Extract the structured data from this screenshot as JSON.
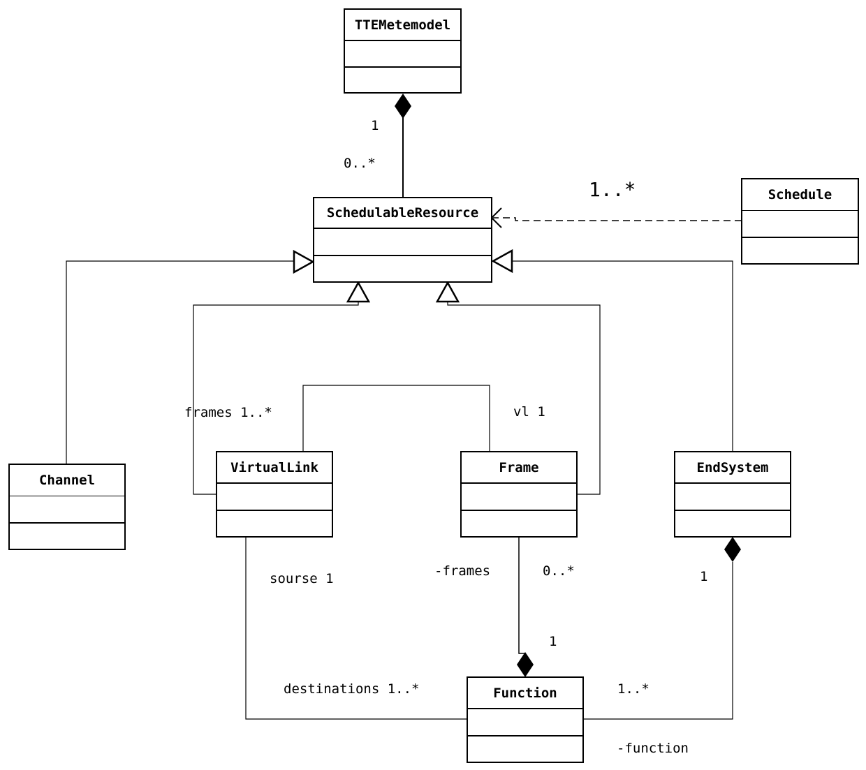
{
  "diagram": {
    "type": "uml-class-diagram",
    "classes": {
      "ttemetemodel": "TTEMetemodel",
      "schedulable_resource": "SchedulableResource",
      "schedule": "Schedule",
      "channel": "Channel",
      "virtual_link": "VirtualLink",
      "frame": "Frame",
      "end_system": "EndSystem",
      "function": "Function"
    },
    "labels": {
      "meta_one": "1",
      "meta_many": "0..*",
      "schedule_mult": "1..*",
      "frames_role": "frames 1..*",
      "vl_role": "vl 1",
      "source_role": "sourse 1",
      "frames_attr": "-frames",
      "frames_mult": "0..*",
      "function_one": "1",
      "end_system_one": "1",
      "destinations_role": "destinations 1..*",
      "function_many": "1..*",
      "function_attr": "-function"
    },
    "relationships": [
      {
        "from": "TTEMetemodel",
        "to": "SchedulableResource",
        "kind": "composition",
        "multiplicity": [
          "1",
          "0..*"
        ]
      },
      {
        "from": "Schedule",
        "to": "SchedulableResource",
        "kind": "dependency",
        "multiplicity": [
          "1..*"
        ]
      },
      {
        "from": "Channel",
        "to": "SchedulableResource",
        "kind": "generalization"
      },
      {
        "from": "VirtualLink",
        "to": "SchedulableResource",
        "kind": "generalization"
      },
      {
        "from": "Frame",
        "to": "SchedulableResource",
        "kind": "generalization"
      },
      {
        "from": "EndSystem",
        "to": "SchedulableResource",
        "kind": "generalization"
      },
      {
        "from": "VirtualLink",
        "to": "Frame",
        "kind": "association",
        "roles": [
          "frames 1..*",
          "vl 1"
        ]
      },
      {
        "from": "Function",
        "to": "Frame",
        "kind": "composition",
        "roles": [
          "-frames 0..*",
          "1"
        ]
      },
      {
        "from": "EndSystem",
        "to": "Function",
        "kind": "composition",
        "roles": [
          "1",
          "1..* -function"
        ]
      },
      {
        "from": "VirtualLink",
        "to": "Function",
        "kind": "association",
        "roles": [
          "sourse 1",
          "destinations 1..*"
        ]
      }
    ]
  }
}
